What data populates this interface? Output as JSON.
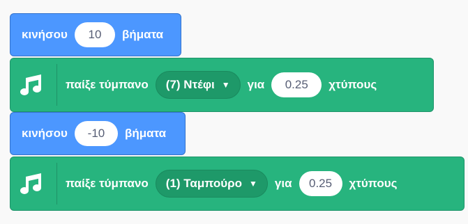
{
  "blocks": [
    {
      "kind": "motion",
      "label_before": "κινήσου",
      "value": "10",
      "label_after": "βήματα"
    },
    {
      "kind": "sound",
      "icon": "music-notes-icon",
      "label_before": "παίξε τύμπανο",
      "dropdown": "(7) Ντέφι",
      "label_mid": "για",
      "value": "0.25",
      "label_after": "χτύπους"
    },
    {
      "kind": "motion",
      "label_before": "κινήσου",
      "value": "-10",
      "label_after": "βήματα"
    },
    {
      "kind": "sound",
      "icon": "music-notes-icon",
      "label_before": "παίξε τύμπανο",
      "dropdown": "(1) Ταμπούρο",
      "label_mid": "για",
      "value": "0.25",
      "label_after": "χτύπους"
    }
  ],
  "colors": {
    "motion": "#4c97ff",
    "sound": "#27b47e",
    "sound_dropdown": "#1e9969",
    "input_text": "#575e75"
  }
}
